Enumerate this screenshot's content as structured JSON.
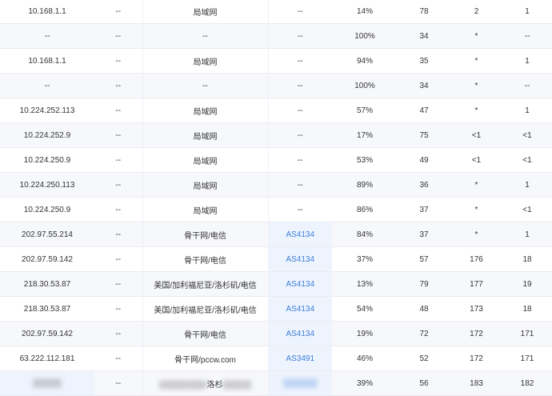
{
  "rows": [
    {
      "ip": "10.168.1.1",
      "host": "--",
      "location": "局域网",
      "asn": "--",
      "loss": "14%",
      "sent": "78",
      "best": "2",
      "worst": "1"
    },
    {
      "ip": "--",
      "host": "--",
      "location": "--",
      "asn": "--",
      "loss": "100%",
      "sent": "34",
      "best": "*",
      "worst": "--"
    },
    {
      "ip": "10.168.1.1",
      "host": "--",
      "location": "局域网",
      "asn": "--",
      "loss": "94%",
      "sent": "35",
      "best": "*",
      "worst": "1"
    },
    {
      "ip": "--",
      "host": "--",
      "location": "--",
      "asn": "--",
      "loss": "100%",
      "sent": "34",
      "best": "*",
      "worst": "--"
    },
    {
      "ip": "10.224.252.113",
      "host": "--",
      "location": "局域网",
      "asn": "--",
      "loss": "57%",
      "sent": "47",
      "best": "*",
      "worst": "1"
    },
    {
      "ip": "10.224.252.9",
      "host": "--",
      "location": "局域网",
      "asn": "--",
      "loss": "17%",
      "sent": "75",
      "best": "<1",
      "worst": "<1"
    },
    {
      "ip": "10.224.250.9",
      "host": "--",
      "location": "局域网",
      "asn": "--",
      "loss": "53%",
      "sent": "49",
      "best": "<1",
      "worst": "<1"
    },
    {
      "ip": "10.224.250.113",
      "host": "--",
      "location": "局域网",
      "asn": "--",
      "loss": "89%",
      "sent": "36",
      "best": "*",
      "worst": "1"
    },
    {
      "ip": "10.224.250.9",
      "host": "--",
      "location": "局域网",
      "asn": "--",
      "loss": "86%",
      "sent": "37",
      "best": "*",
      "worst": "<1"
    },
    {
      "ip": "202.97.55.214",
      "host": "--",
      "location": "骨干网/电信",
      "asn": "AS4134",
      "loss": "84%",
      "sent": "37",
      "best": "*",
      "worst": "1"
    },
    {
      "ip": "202.97.59.142",
      "host": "--",
      "location": "骨干网/电信",
      "asn": "AS4134",
      "loss": "37%",
      "sent": "57",
      "best": "176",
      "worst": "18"
    },
    {
      "ip": "218.30.53.87",
      "host": "--",
      "location": "美国/加利福尼亚/洛杉矶/电信",
      "asn": "AS4134",
      "loss": "13%",
      "sent": "79",
      "best": "177",
      "worst": "19"
    },
    {
      "ip": "218.30.53.87",
      "host": "--",
      "location": "美国/加利福尼亚/洛杉矶/电信",
      "asn": "AS4134",
      "loss": "54%",
      "sent": "48",
      "best": "173",
      "worst": "18"
    },
    {
      "ip": "202.97.59.142",
      "host": "--",
      "location": "骨干网/电信",
      "asn": "AS4134",
      "loss": "19%",
      "sent": "72",
      "best": "172",
      "worst": "171"
    },
    {
      "ip": "63.222.112.181",
      "host": "--",
      "location": "骨干网/pccw.com",
      "asn": "AS3491",
      "loss": "46%",
      "sent": "52",
      "best": "172",
      "worst": "171"
    },
    {
      "ip": "",
      "host": "--",
      "location": "洛杉",
      "asn": "",
      "loss": "39%",
      "sent": "56",
      "best": "183",
      "worst": "182",
      "redacted": true
    }
  ]
}
